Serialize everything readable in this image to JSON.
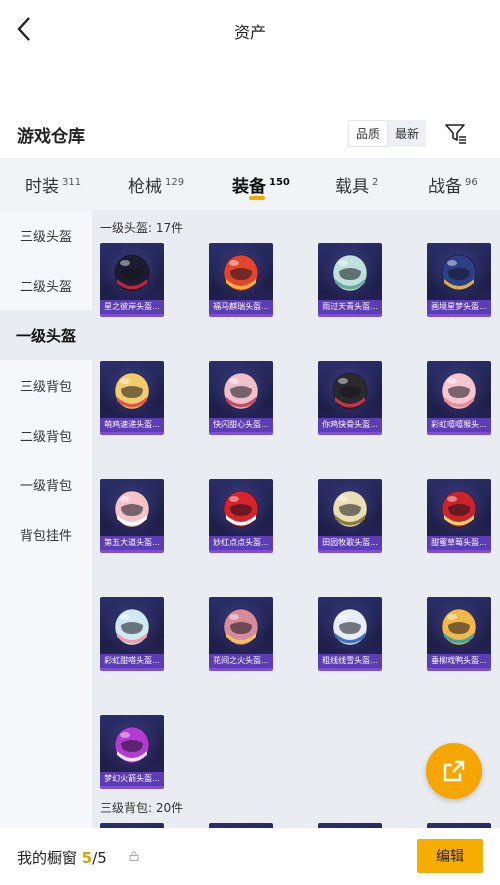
{
  "header": {
    "title": "资产"
  },
  "warehouse": {
    "title": "游戏仓库",
    "sort_options": [
      "品质",
      "最新"
    ]
  },
  "tabs": [
    {
      "label": "时装",
      "count": "311"
    },
    {
      "label": "枪械",
      "count": "129"
    },
    {
      "label": "装备",
      "count": "150"
    },
    {
      "label": "载具",
      "count": "2"
    },
    {
      "label": "战备",
      "count": "96"
    }
  ],
  "sidebar": [
    "三级头盔",
    "二级头盔",
    "一级头盔",
    "三级背包",
    "二级背包",
    "一级背包",
    "背包挂件"
  ],
  "groups": [
    {
      "title": "一级头盔: 17件"
    },
    {
      "title": "三级背包: 20件"
    }
  ],
  "items": [
    {
      "name": "星之彼岸头盔...",
      "shell": "#1b1d2e",
      "accent": "#c8223a"
    },
    {
      "name": "福马麒瑞头盔...",
      "shell": "#e2442c",
      "accent": "#f0b243"
    },
    {
      "name": "雨过天青头盔...",
      "shell": "#bfe0dc",
      "accent": "#6aa7a0"
    },
    {
      "name": "画境星梦头盔...",
      "shell": "#2c3e86",
      "accent": "#d9b04a"
    },
    {
      "name": "萌鸡速递头盔...",
      "shell": "#f2cd6b",
      "accent": "#e0524a"
    },
    {
      "name": "快闪甜心头盔...",
      "shell": "#efc0cc",
      "accent": "#c24a6a"
    },
    {
      "name": "你鸡快骨头盔...",
      "shell": "#2a2a2e",
      "accent": "#cc3344"
    },
    {
      "name": "彩虹嘻嘻猴头...",
      "shell": "#f5c6cf",
      "accent": "#e58aa0"
    },
    {
      "name": "第五大道头盔...",
      "shell": "#f3c3c8",
      "accent": "#ffffff"
    },
    {
      "name": "妙红点点头盔...",
      "shell": "#d6232c",
      "accent": "#ffffff"
    },
    {
      "name": "田园牧歌头盔...",
      "shell": "#e9dfb5",
      "accent": "#8a7a40"
    },
    {
      "name": "甜蜜草莓头盔...",
      "shell": "#c9232c",
      "accent": "#f7d36a"
    },
    {
      "name": "彩虹甜嗒头盔...",
      "shell": "#cfe9ee",
      "accent": "#f09ab0"
    },
    {
      "name": "花间之火头盔...",
      "shell": "#d68a9a",
      "accent": "#f3c25d"
    },
    {
      "name": "粗线线雪头盔...",
      "shell": "#e7eef7",
      "accent": "#3b6fc9"
    },
    {
      "name": "垂柳戏鸭头盔...",
      "shell": "#f2b84a",
      "accent": "#3aa8a0"
    },
    {
      "name": "梦幻火箭头盔...",
      "shell": "#b23bd0",
      "accent": "#f1e4f6"
    }
  ],
  "bottom": {
    "label": "我的橱窗",
    "current": "5",
    "total": "/5",
    "edit_label": "编辑"
  },
  "colors": {
    "accent": "#f5ad00",
    "card_bar": "#5d3db5"
  },
  "icons": [
    "back-arrow-icon",
    "filter-icon",
    "share-export-icon",
    "lock-icon"
  ]
}
